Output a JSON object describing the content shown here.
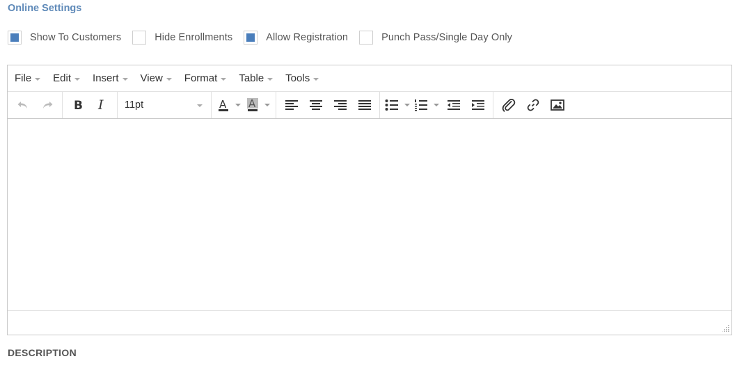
{
  "section": {
    "title": "Online Settings"
  },
  "checkboxes": [
    {
      "label": "Show To Customers",
      "checked": true
    },
    {
      "label": "Hide Enrollments",
      "checked": false
    },
    {
      "label": "Allow Registration",
      "checked": true
    },
    {
      "label": "Punch Pass/Single Day Only",
      "checked": false
    }
  ],
  "editor": {
    "menu": [
      "File",
      "Edit",
      "Insert",
      "View",
      "Format",
      "Table",
      "Tools"
    ],
    "font_size": "11pt",
    "content": ""
  },
  "description": {
    "label": "DESCRIPTION"
  },
  "colors": {
    "accent": "#4a7ebb",
    "title": "#5e89b8",
    "border": "#c8c8c8"
  },
  "icons": [
    "undo-icon",
    "redo-icon",
    "bold-icon",
    "italic-icon",
    "text-color-icon",
    "background-color-icon",
    "align-left-icon",
    "align-center-icon",
    "align-right-icon",
    "align-justify-icon",
    "bullet-list-icon",
    "numbered-list-icon",
    "outdent-icon",
    "indent-icon",
    "attachment-icon",
    "link-icon",
    "image-icon",
    "resize-handle-icon"
  ]
}
